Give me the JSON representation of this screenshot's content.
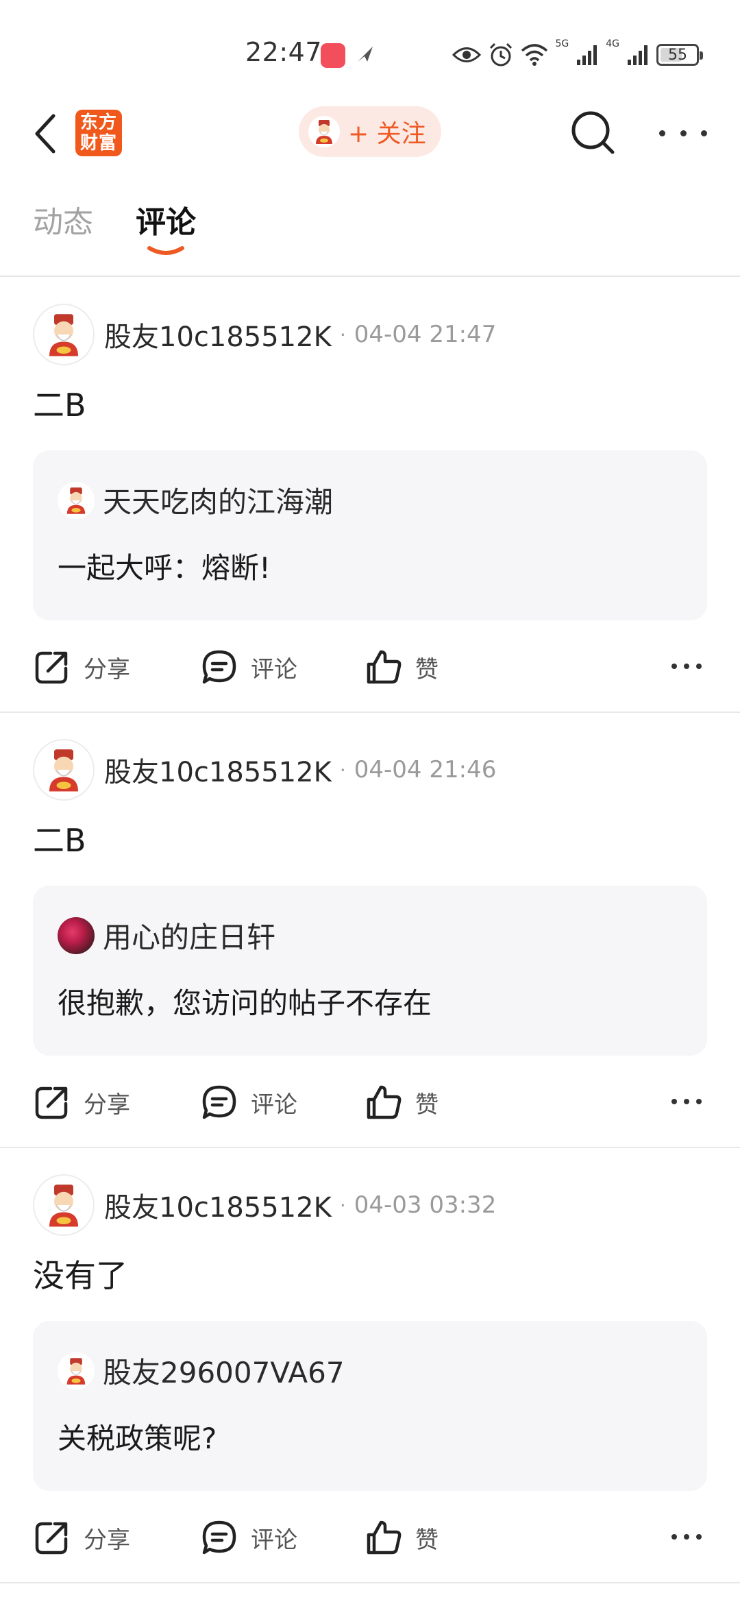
{
  "status_bar": {
    "time": "22:47",
    "network_left": "5G",
    "network_right": "4G",
    "battery": "55",
    "icons": [
      "huawei-app-icon",
      "send-icon",
      "eye-icon",
      "alarm-icon",
      "wifi-icon",
      "signal-icon",
      "signal-icon",
      "battery-icon"
    ]
  },
  "header": {
    "logo_line1": "东方",
    "logo_line2": "财富",
    "follow_label": "+ 关注",
    "accent_color": "#ee5a24"
  },
  "tabs": [
    {
      "label": "动态",
      "active": false
    },
    {
      "label": "评论",
      "active": true
    }
  ],
  "posts": [
    {
      "username": "股友10c185512K",
      "time": "04-04 21:47",
      "text": "二B",
      "quote": {
        "username": "天天吃肉的江海潮",
        "text": "一起大呼：熔断!",
        "avatar": "fortune-god"
      }
    },
    {
      "username": "股友10c185512K",
      "time": "04-04 21:46",
      "text": "二B",
      "quote": {
        "username": "用心的庄日轩",
        "text": "很抱歉，您访问的帖子不存在",
        "avatar": "flower"
      }
    },
    {
      "username": "股友10c185512K",
      "time": "04-03 03:32",
      "text": "没有了",
      "quote": {
        "username": "股友296007VA67",
        "text": "关税政策呢?",
        "avatar": "fortune-god"
      }
    }
  ],
  "actions": {
    "share": "分享",
    "comment": "评论",
    "like": "赞"
  }
}
